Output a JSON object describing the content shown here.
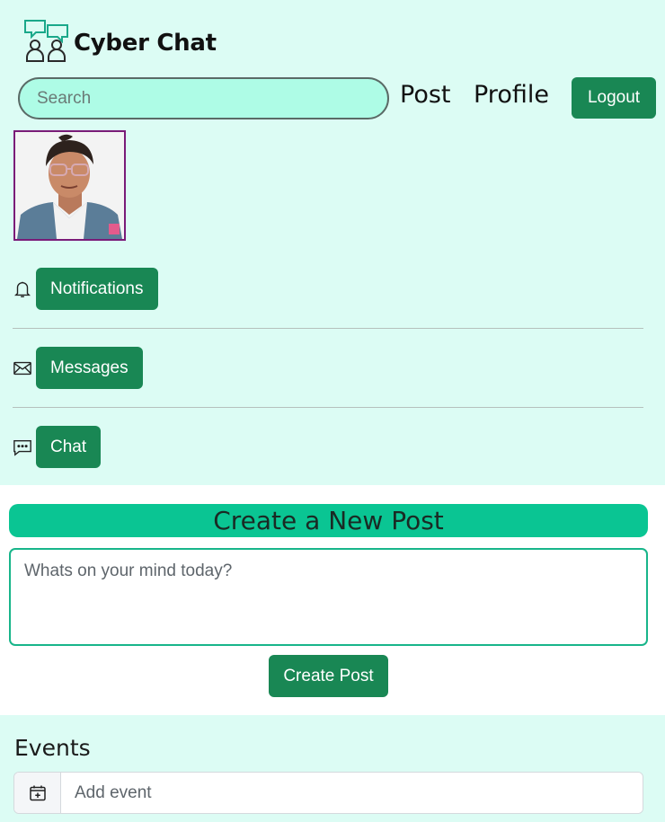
{
  "app": {
    "title": "Cyber Chat",
    "logo_icon": "people-chat-icon"
  },
  "header": {
    "search_placeholder": "Search",
    "nav_post": "Post",
    "nav_profile": "Profile",
    "logout_label": "Logout"
  },
  "sidebar": {
    "items": [
      {
        "icon": "bell-icon",
        "label": "Notifications"
      },
      {
        "icon": "envelope-icon",
        "label": "Messages"
      },
      {
        "icon": "chat-dots-icon",
        "label": "Chat"
      }
    ]
  },
  "create_post": {
    "title": "Create a New Post",
    "placeholder": "Whats on your mind today?",
    "button_label": "Create Post"
  },
  "events": {
    "title": "Events",
    "add_placeholder": "Add event",
    "icon": "calendar-plus-icon"
  },
  "colors": {
    "page_bg": "#dcfcf4",
    "search_bg": "#aefce6",
    "button_green": "#198754",
    "header_bar": "#0ac593",
    "avatar_border": "#7a1b78"
  }
}
